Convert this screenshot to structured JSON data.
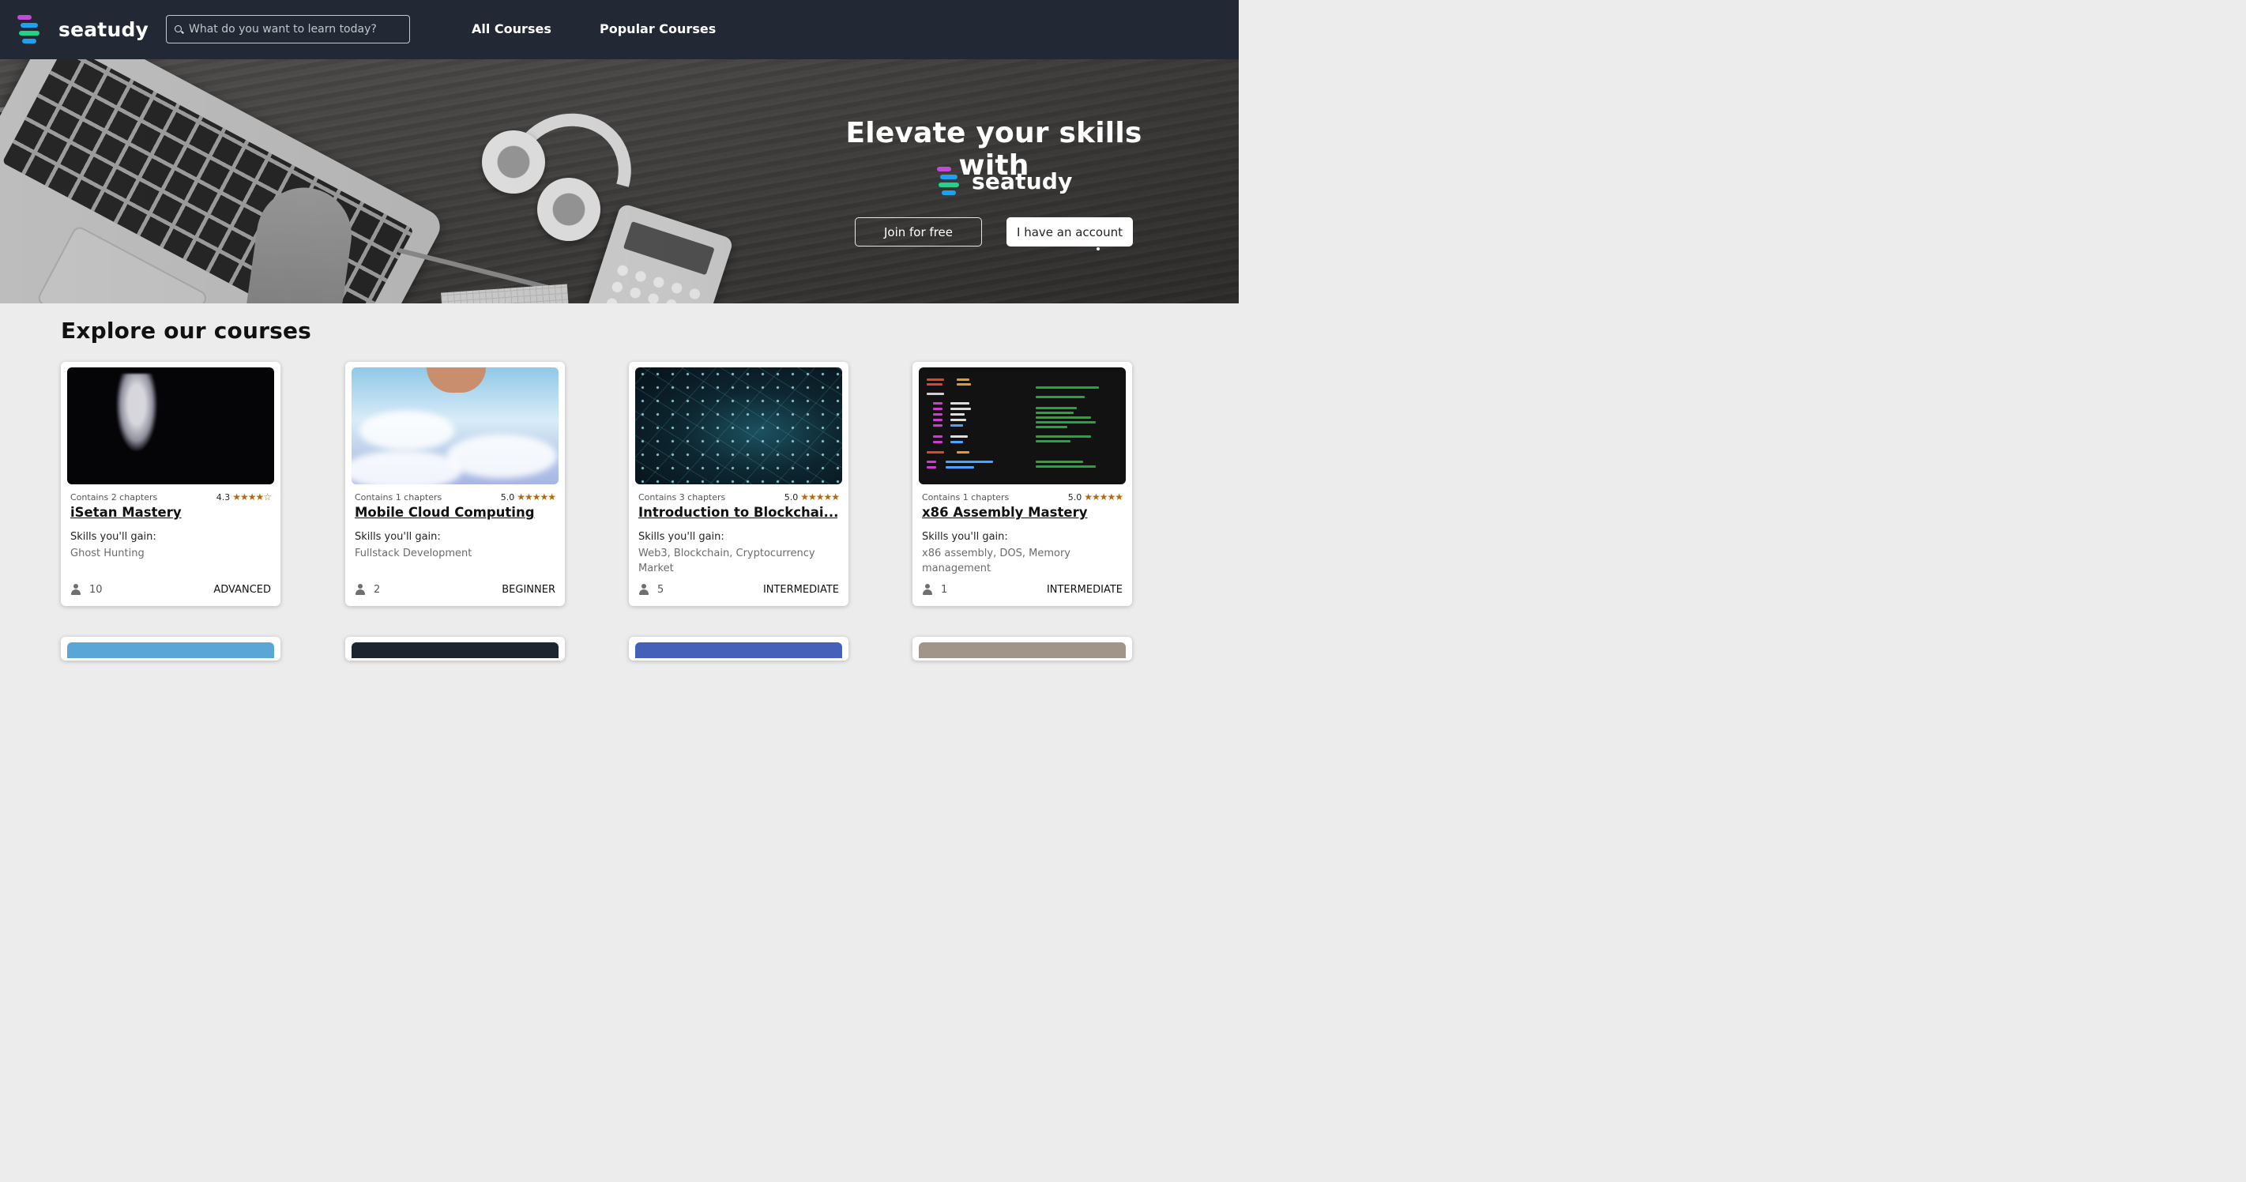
{
  "brand": {
    "name": "seatudy",
    "logo_colors": [
      "#c24bd6",
      "#1da1f2",
      "#23d18b",
      "#f5a623"
    ]
  },
  "search": {
    "placeholder": "What do you want to learn today?"
  },
  "nav": {
    "links": [
      {
        "label": "All Courses"
      },
      {
        "label": "Popular Courses"
      }
    ]
  },
  "hero": {
    "title": "Elevate your skills with",
    "brand_name": "seatudy",
    "buttons": {
      "join": "Join for free",
      "account": "I have an account"
    }
  },
  "section": {
    "title": "Explore our courses"
  },
  "courses": [
    {
      "chapters": "Contains 2 chapters",
      "rating": "4.3",
      "stars": "★★★★☆",
      "title": "iSetan Mastery",
      "skills_label": "Skills you'll gain:",
      "skills": "Ghost Hunting",
      "learners": "10",
      "level": "ADVANCED"
    },
    {
      "chapters": "Contains 1 chapters",
      "rating": "5.0",
      "stars": "★★★★★",
      "title": "Mobile Cloud Computing",
      "skills_label": "Skills you'll gain:",
      "skills": "Fullstack Development",
      "learners": "2",
      "level": "BEGINNER"
    },
    {
      "chapters": "Contains 3 chapters",
      "rating": "5.0",
      "stars": "★★★★★",
      "title": "Introduction to Blockchai...",
      "skills_label": "Skills you'll gain:",
      "skills": "Web3, Blockchain, Cryptocurrency Market",
      "learners": "5",
      "level": "INTERMEDIATE"
    },
    {
      "chapters": "Contains 1 chapters",
      "rating": "5.0",
      "stars": "★★★★★",
      "title": "x86 Assembly Mastery",
      "skills_label": "Skills you'll gain:",
      "skills": "x86 assembly, DOS, Memory management",
      "learners": "1",
      "level": "INTERMEDIATE"
    }
  ],
  "colors": {
    "navbar": "#222834",
    "star": "#b4690e",
    "page_bg": "#ececec"
  }
}
